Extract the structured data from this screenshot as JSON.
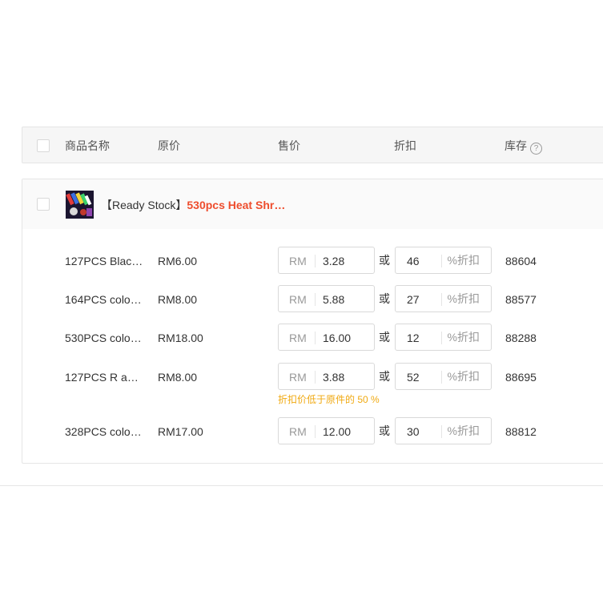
{
  "header": {
    "product_name": "商品名称",
    "original_price": "原价",
    "sale_price": "售价",
    "discount": "折扣",
    "stock": "库存",
    "help_icon": "?"
  },
  "product": {
    "tag": "【Ready Stock】",
    "name": "530pcs Heat Shr…",
    "variants": [
      {
        "name": "127PCS Blac…",
        "price": "RM6.00",
        "currency": "RM",
        "sale": "3.28",
        "or": "或",
        "discount": "46",
        "unit": "%折扣",
        "stock": "88604"
      },
      {
        "name": "164PCS colo…",
        "price": "RM8.00",
        "currency": "RM",
        "sale": "5.88",
        "or": "或",
        "discount": "27",
        "unit": "%折扣",
        "stock": "88577"
      },
      {
        "name": "530PCS colo…",
        "price": "RM18.00",
        "currency": "RM",
        "sale": "16.00",
        "or": "或",
        "discount": "12",
        "unit": "%折扣",
        "stock": "88288"
      },
      {
        "name": "127PCS R a…",
        "price": "RM8.00",
        "currency": "RM",
        "sale": "3.88",
        "or": "或",
        "discount": "52",
        "unit": "%折扣",
        "stock": "88695"
      },
      {
        "name": "328PCS colo…",
        "price": "RM17.00",
        "currency": "RM",
        "sale": "12.00",
        "or": "或",
        "discount": "30",
        "unit": "%折扣",
        "stock": "88812"
      }
    ],
    "warning": "折扣价低于原件的 50 %"
  },
  "colors": {
    "accent": "#ee4d2d",
    "warning": "#f0a911"
  }
}
